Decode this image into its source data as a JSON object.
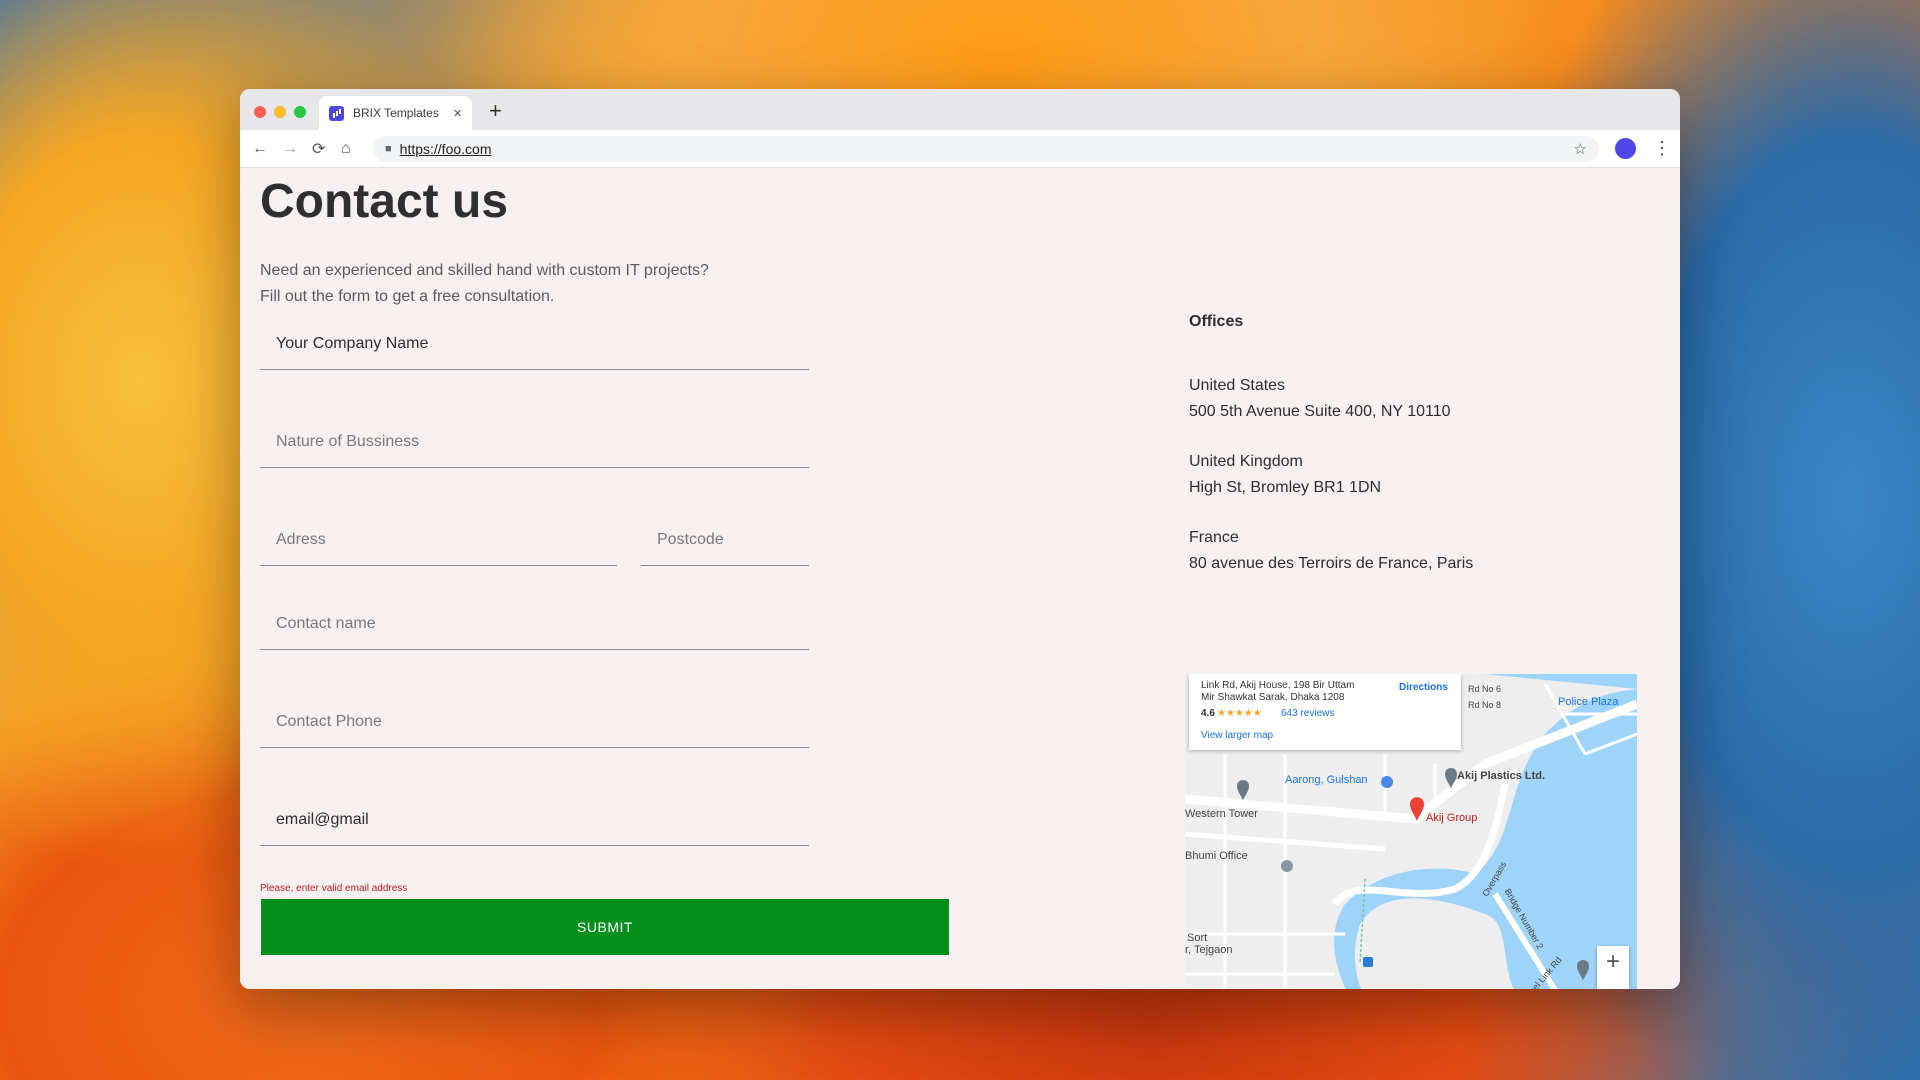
{
  "browser": {
    "tab_title": "BRIX Templates",
    "tab_close": "×",
    "new_tab": "+",
    "url": "https://foo.com",
    "nav": {
      "back": "←",
      "forward": "→",
      "reload": "⟳",
      "home": "⌂"
    },
    "bookmark": "☆",
    "menu": "⋮",
    "traffic_lights": [
      "#ff5f57",
      "#febc2e",
      "#28c840"
    ]
  },
  "page": {
    "title": "Contact us",
    "intro_line1": "Need an experienced and skilled hand with custom IT projects?",
    "intro_line2": "Fill out the form to get a free consultation.",
    "form": {
      "company": {
        "value": "Your Company Name",
        "placeholder": ""
      },
      "business": {
        "value": "",
        "placeholder": "Nature of Bussiness"
      },
      "address": {
        "value": "",
        "placeholder": "Adress"
      },
      "postcode": {
        "value": "",
        "placeholder": "Postcode"
      },
      "contact_name": {
        "value": "",
        "placeholder": "Contact name"
      },
      "contact_phone": {
        "value": "",
        "placeholder": "Contact Phone"
      },
      "email": {
        "value": "email@gmail",
        "placeholder": ""
      },
      "error": "Please, enter valid email address",
      "submit": "SUBMIT",
      "submit_color": "#048f1d"
    },
    "offices": {
      "heading": "Offices",
      "list": [
        {
          "country": "United States",
          "address": "500 5th Avenue Suite 400, NY 10110"
        },
        {
          "country": "United Kingdom",
          "address": "High St, Bromley BR1 1DN"
        },
        {
          "country": "France",
          "address": "80 avenue des Terroirs de France, Paris"
        }
      ]
    },
    "map": {
      "card": {
        "address_line1": "Link Rd, Akij House, 198 Bir Uttam",
        "address_line2": "Mir Shawkat Sarak, Dhaka 1208",
        "directions": "Directions",
        "rating": "4.6",
        "stars": "★★★★★",
        "reviews": "643 reviews",
        "view_larger": "View larger map"
      },
      "labels": {
        "aarong": "Aarong, Gulshan",
        "akij_plastics": "Akij Plastics Ltd.",
        "akij_group": "Akij Group",
        "western_tower": "Western Tower",
        "bhumi_office": "Bhumi Office",
        "police_plaza": "Police Plaza",
        "sort_tejgaon_1": "Sort",
        "sort_tejgaon_2": "r, Tejgaon",
        "overpass": "Overpass",
        "bridge": "Bridge Number 2",
        "rd_no6": "Rd No 6",
        "rd_no8": "Rd No 8",
        "jheel_link": "Jheel Link Rd"
      },
      "zoom_in": "+",
      "zoom_out": "−"
    }
  }
}
